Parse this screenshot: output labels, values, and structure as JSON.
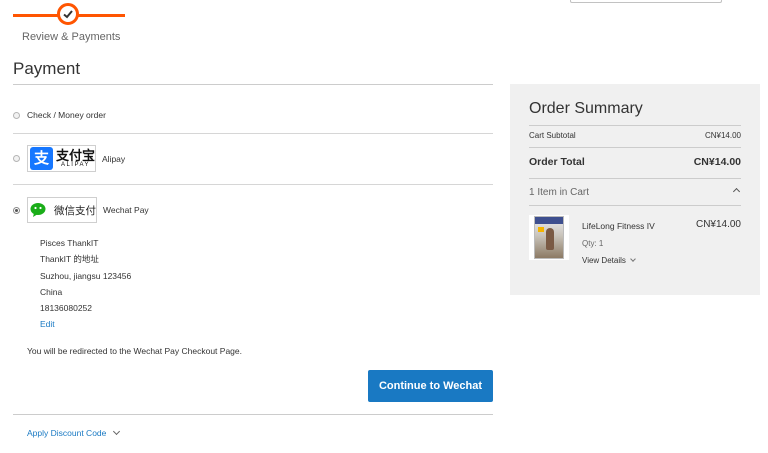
{
  "progress": {
    "step_label": "Review & Payments",
    "accent_color": "#ff5501",
    "step_icon": "check-icon"
  },
  "payment": {
    "title": "Payment",
    "methods": [
      {
        "label": "Check / Money order",
        "selected": false
      },
      {
        "label": "Alipay",
        "selected": false,
        "logo_cn": "支付宝",
        "logo_en": "ALIPAY",
        "logo_glyph": "支"
      },
      {
        "label": "Wechat Pay",
        "selected": true,
        "logo_cn": "微信支付"
      }
    ],
    "address": {
      "name": "Pisces ThankIT",
      "street": "ThankIT 的地址",
      "city_line": "Suzhou, jiangsu 123456",
      "country": "China",
      "phone": "18136080252",
      "edit_label": "Edit"
    },
    "redirect_note": "You will be redirected to the Wechat Pay Checkout Page.",
    "continue_label": "Continue to Wechat",
    "button_color": "#1979c3",
    "discount_label": "Apply Discount Code"
  },
  "summary": {
    "title": "Order Summary",
    "subtotal_label": "Cart Subtotal",
    "subtotal_value": "CN¥14.00",
    "total_label": "Order Total",
    "total_value": "CN¥14.00",
    "items_label": "1 Item in Cart",
    "item": {
      "name": "LifeLong Fitness IV",
      "price": "CN¥14.00",
      "qty_label": "Qty: 1",
      "details_label": "View Details"
    }
  }
}
